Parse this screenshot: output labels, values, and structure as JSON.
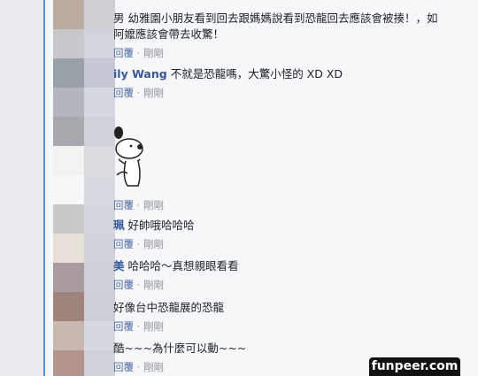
{
  "comments": [
    {
      "name": "",
      "text_line1": "男 幼雅園小朋友看到回去跟媽媽說看到恐龍回去應該會被揍！，如",
      "text_line2": "阿嬤應該會帶去收驚！",
      "meta_reply": "回覆",
      "meta_time": "剛剛"
    },
    {
      "name": "ily Wang",
      "text": "不就是恐龍嗎，大驚小怪的 XD XD",
      "meta_reply": "回覆",
      "meta_time": "剛剛"
    },
    {
      "name": "",
      "text": "",
      "meta_reply": "回覆",
      "meta_time": "剛剛"
    },
    {
      "name": "珮",
      "text": "好帥哦哈哈哈",
      "meta_reply": "回覆",
      "meta_time": "剛剛"
    },
    {
      "name": "美",
      "text": "哈哈哈～真想親眼看看",
      "meta_reply": "回覆",
      "meta_time": "剛剛"
    },
    {
      "name": "",
      "text": "好像台中恐龍展的恐龍",
      "meta_reply": "回覆",
      "meta_time": "剛剛"
    },
    {
      "name": "",
      "text": "酷~~~為什麼可以動~~~",
      "meta_reply": "回覆",
      "meta_time": "剛剛"
    }
  ],
  "watermark": "funpeer.com",
  "colors": {
    "thread_line": "#5b8bd7",
    "name_link": "#365899",
    "meta": "#90949c"
  }
}
